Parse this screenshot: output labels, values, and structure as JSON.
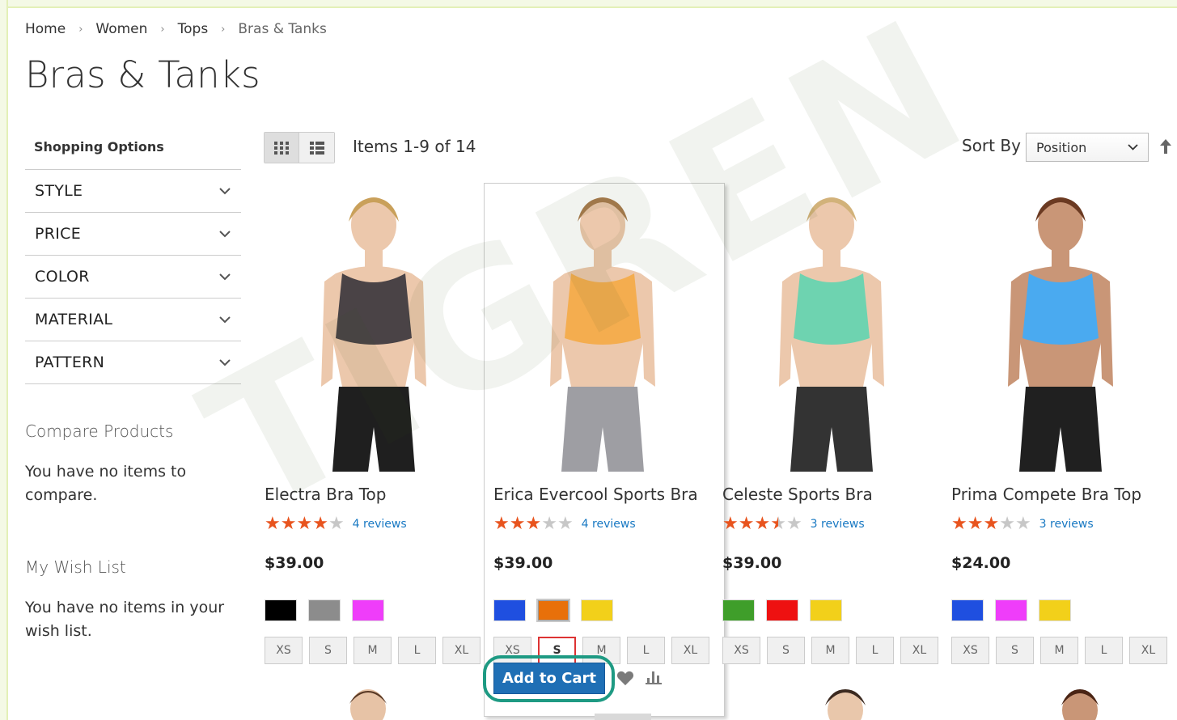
{
  "breadcrumb": [
    {
      "label": "Home"
    },
    {
      "label": "Women"
    },
    {
      "label": "Tops"
    },
    {
      "label": "Bras & Tanks"
    }
  ],
  "page_title": "Bras & Tanks",
  "sidebar": {
    "shopping_options_title": "Shopping Options",
    "filters": [
      {
        "label": "STYLE"
      },
      {
        "label": "PRICE"
      },
      {
        "label": "COLOR"
      },
      {
        "label": "MATERIAL"
      },
      {
        "label": "PATTERN"
      }
    ],
    "compare": {
      "title": "Compare Products",
      "text": "You have no items to compare."
    },
    "wishlist": {
      "title": "My Wish List",
      "text": "You have no items in your wish list."
    }
  },
  "toolbar": {
    "view_modes": [
      "grid-icon",
      "list-icon"
    ],
    "active_view": "grid",
    "items_count": "Items 1-9 of 14",
    "sort_label": "Sort By",
    "sort_value": "Position"
  },
  "products": [
    {
      "name": "Electra Bra Top",
      "rating": 4,
      "reviews": "4 reviews",
      "price": "$39.00",
      "swatches": [
        "#000000",
        "#8c8c8c",
        "#ef3dfa"
      ],
      "sizes": [
        "XS",
        "S",
        "M",
        "L",
        "XL"
      ],
      "top_color": "#4a4346",
      "bottom_color": "#1f1f1f",
      "hair_color": "#c9a05a"
    },
    {
      "name": "Erica Evercool Sports Bra",
      "rating": 3,
      "reviews": "4 reviews",
      "price": "$39.00",
      "swatches": [
        "#1f4fe0",
        "#e8700a",
        "#f2d01a"
      ],
      "selected_swatch": 1,
      "sizes": [
        "XS",
        "S",
        "M",
        "L",
        "XL"
      ],
      "selected_size": 1,
      "top_color": "#f4ad4f",
      "bottom_color": "#9e9ea3",
      "hair_color": "#a87b4e"
    },
    {
      "name": "Celeste Sports Bra",
      "rating": 3.5,
      "reviews": "3 reviews",
      "price": "$39.00",
      "swatches": [
        "#3f9e2a",
        "#ee1111",
        "#f2d01a"
      ],
      "sizes": [
        "XS",
        "S",
        "M",
        "L",
        "XL"
      ],
      "top_color": "#6ed3b0",
      "bottom_color": "#333333",
      "hair_color": "#d2b27a"
    },
    {
      "name": "Prima Compete Bra Top",
      "rating": 3,
      "reviews": "3 reviews",
      "price": "$24.00",
      "swatches": [
        "#1f4fe0",
        "#ef3dfa",
        "#f2d01a"
      ],
      "sizes": [
        "XS",
        "S",
        "M",
        "L",
        "XL"
      ],
      "top_color": "#4aaaf0",
      "bottom_color": "#202020",
      "hair_color": "#6b3a22"
    }
  ],
  "hover_actions": {
    "add_to_cart": "Add to Cart"
  },
  "watermark": "TIGREN",
  "colors": {
    "accent": "#1979c3",
    "button": "#1f6fb5",
    "star": "#e8541e",
    "highlight_ring": "#1e9a83"
  }
}
